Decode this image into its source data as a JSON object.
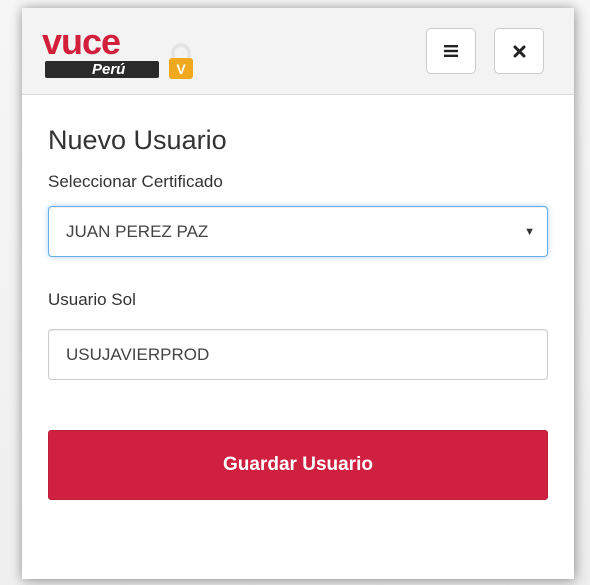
{
  "header": {
    "logo": {
      "word": "vuce",
      "country": "Perú",
      "badge_letter": "V"
    },
    "menu_icon": "hamburger-icon",
    "close_icon": "close-icon"
  },
  "form": {
    "title": "Nuevo Usuario",
    "certificate_label": "Seleccionar Certificado",
    "certificate_value": "JUAN PEREZ PAZ",
    "sol_user_label": "Usuario Sol",
    "sol_user_value": "USUJAVIERPROD",
    "save_label": "Guardar Usuario"
  },
  "colors": {
    "brand_red": "#d0203f",
    "lock_gold": "#f0a81e",
    "focus_blue": "#66afe9"
  }
}
